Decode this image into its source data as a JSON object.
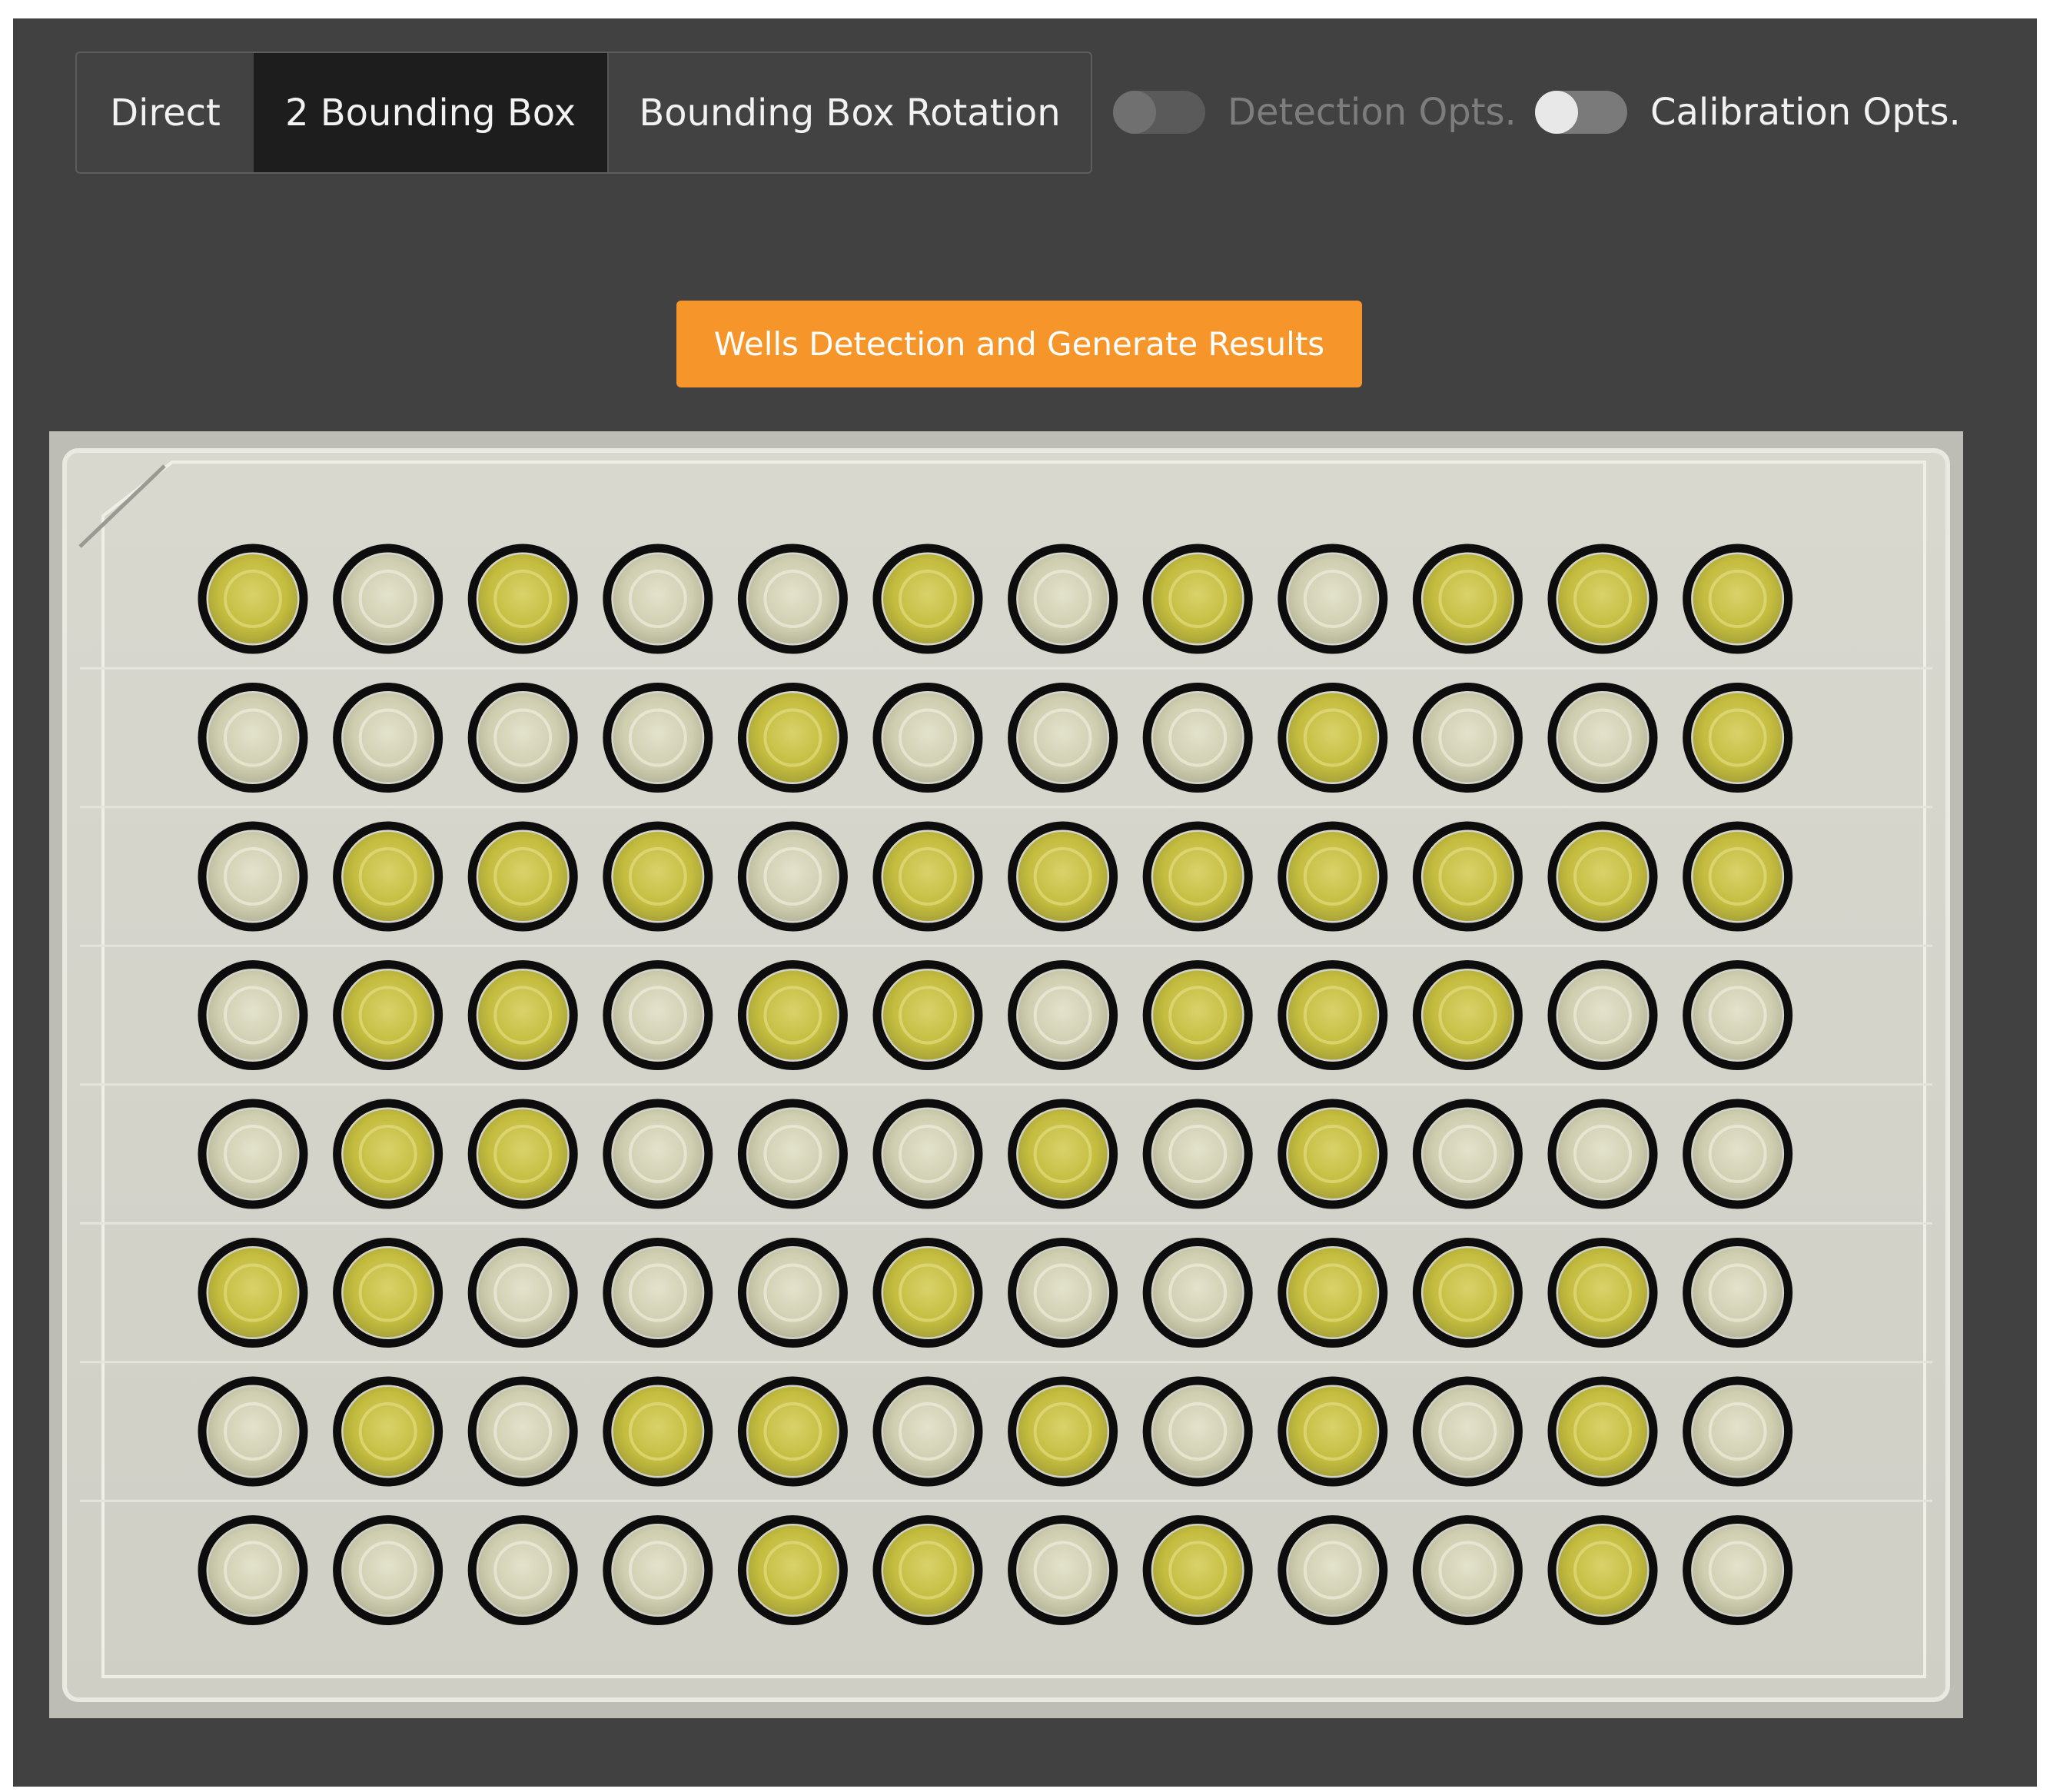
{
  "modes": [
    {
      "label": "Direct",
      "active": false
    },
    {
      "label": "2 Bounding Box",
      "active": true
    },
    {
      "label": "Bounding Box Rotation",
      "active": false
    }
  ],
  "toggles": {
    "detection": {
      "label": "Detection Opts.",
      "enabled": false,
      "on": false
    },
    "calibration": {
      "label": "Calibration Opts.",
      "enabled": true,
      "on": false
    }
  },
  "action_button": {
    "label": "Wells Detection and Generate Results"
  },
  "colors": {
    "panel_bg": "#414141",
    "active_mode_bg": "#1d1d1d",
    "action_orange": "#f6962a",
    "well_yellow": "#c9c24a",
    "well_pale": "#d5d4b4",
    "detection_ring": "#0d0d0d"
  },
  "plate": {
    "rows": 8,
    "columns": 12,
    "wells": [
      [
        "Y",
        "P",
        "Y",
        "P",
        "P",
        "Y",
        "P",
        "Y",
        "P",
        "Y",
        "Y",
        "Y"
      ],
      [
        "P",
        "P",
        "P",
        "P",
        "Y",
        "P",
        "P",
        "P",
        "Y",
        "P",
        "P",
        "Y"
      ],
      [
        "P",
        "Y",
        "Y",
        "Y",
        "P",
        "Y",
        "Y",
        "Y",
        "Y",
        "Y",
        "Y",
        "Y"
      ],
      [
        "P",
        "Y",
        "Y",
        "P",
        "Y",
        "Y",
        "P",
        "Y",
        "Y",
        "Y",
        "P",
        "P"
      ],
      [
        "P",
        "Y",
        "Y",
        "P",
        "P",
        "P",
        "Y",
        "P",
        "Y",
        "P",
        "P",
        "P"
      ],
      [
        "Y",
        "Y",
        "P",
        "P",
        "P",
        "Y",
        "P",
        "P",
        "Y",
        "Y",
        "Y",
        "P"
      ],
      [
        "P",
        "Y",
        "P",
        "Y",
        "Y",
        "P",
        "Y",
        "P",
        "Y",
        "P",
        "Y",
        "P"
      ],
      [
        "P",
        "P",
        "P",
        "P",
        "Y",
        "Y",
        "P",
        "Y",
        "P",
        "P",
        "Y",
        "P"
      ]
    ]
  }
}
